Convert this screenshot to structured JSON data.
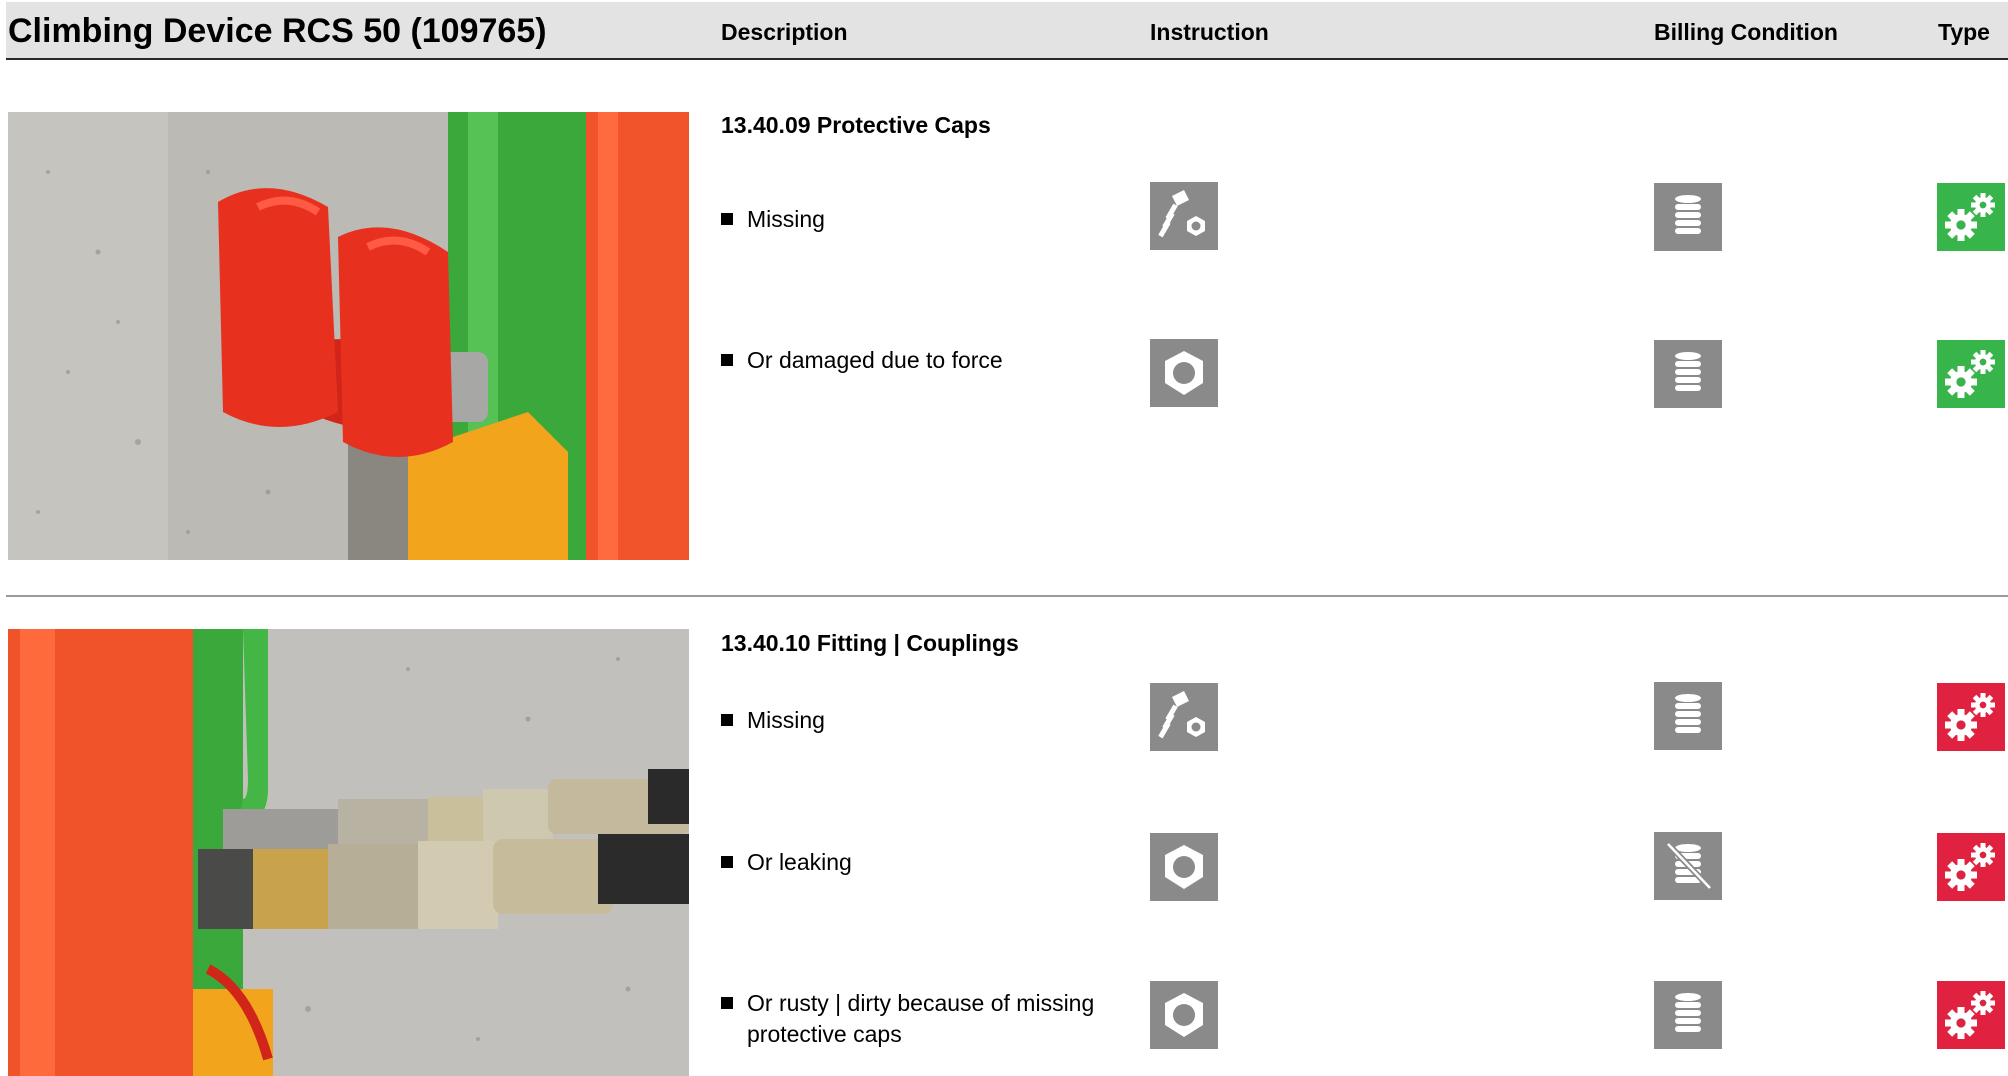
{
  "header": {
    "title": "Climbing Device RCS 50 (109765)",
    "col_description": "Description",
    "col_instruction": "Instruction",
    "col_billing": "Billing Condition",
    "col_type": "Type"
  },
  "sections": [
    {
      "title": "13.40.09 Protective Caps",
      "items": [
        {
          "text": "Missing",
          "instruction_icon": "bolt-nut-icon",
          "billing_icon": "coin-stack-icon",
          "type_icon": "gears-icon"
        },
        {
          "text": "Or damaged due to force",
          "instruction_icon": "nut-icon",
          "billing_icon": "coin-stack-icon",
          "type_icon": "gears-icon"
        }
      ],
      "type_color": "#38b54a"
    },
    {
      "title": "13.40.10 Fitting | Couplings",
      "items": [
        {
          "text": "Missing",
          "instruction_icon": "bolt-nut-icon",
          "billing_icon": "coin-stack-icon",
          "type_icon": "gears-icon"
        },
        {
          "text": "Or leaking",
          "instruction_icon": "nut-icon",
          "billing_icon": "coin-stack-crossed-icon",
          "type_icon": "gears-icon"
        },
        {
          "text_line1": "Or rusty | dirty because of missing",
          "text_line2": "protective caps",
          "instruction_icon": "nut-icon",
          "billing_icon": "coin-stack-icon",
          "type_icon": "gears-icon"
        }
      ],
      "type_color": "#e0213f"
    }
  ]
}
